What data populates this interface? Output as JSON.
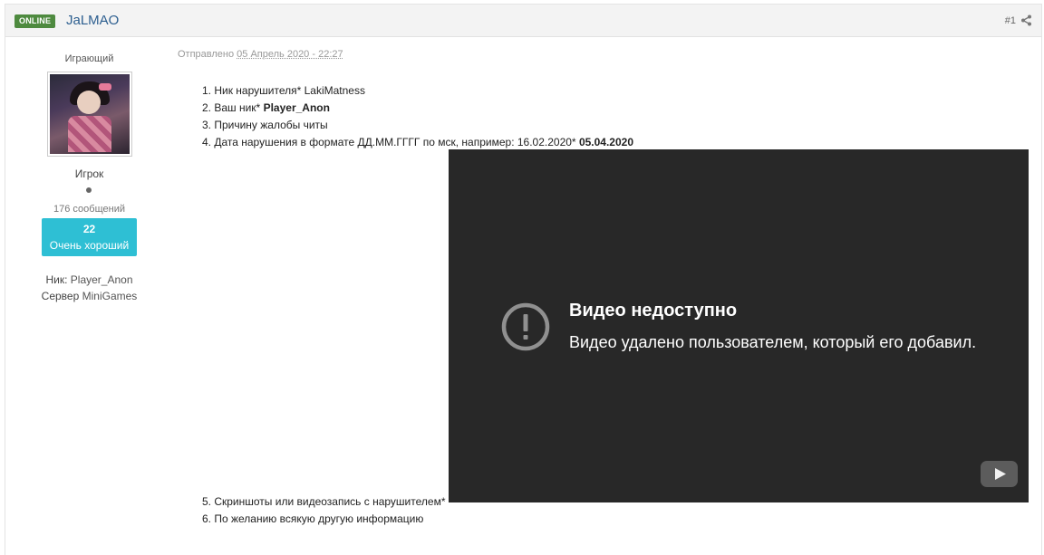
{
  "header": {
    "online_badge": "ONLINE",
    "author_name": "JaLMAO",
    "post_number": "#1",
    "share_icon": "share-icon"
  },
  "author": {
    "user_title": "Играющий",
    "group": "Игрок",
    "post_count": "176 сообщений",
    "reputation_value": "22",
    "reputation_label": "Очень хороший",
    "nick_label": "Ник:",
    "nick_value": "Player_Anon",
    "server_label": "Сервер",
    "server_value": "MiniGames"
  },
  "post": {
    "sent_label": "Отправлено",
    "date": "05 Апрель 2020 - 22:27",
    "items": [
      {
        "text": "1. Ник нарушителя* LakiMatness",
        "bold": ""
      },
      {
        "text": "2. Ваш ник* ",
        "bold": "Player_Anon"
      },
      {
        "text": "3. Причину жалобы читы",
        "bold": ""
      },
      {
        "text": "4. Дата нарушения в формате ДД.ММ.ГГГГ по мск, например: 16.02.2020* ",
        "bold": "05.04.2020"
      },
      {
        "text": "5. Скриншоты или видеозапись с нарушителем*",
        "bold": ""
      },
      {
        "text": "6. По желанию всякую другую информацию",
        "bold": ""
      }
    ]
  },
  "video": {
    "title": "Видео недоступно",
    "message": "Видео удалено пользователем, который его добавил.",
    "error_icon": "exclamation-circle-icon",
    "logo_icon": "youtube-play-icon",
    "background": "#282828"
  },
  "colors": {
    "online_badge": "#4e8a3f",
    "author_link": "#2c5e8f",
    "reputation": "#2ebfd4"
  }
}
